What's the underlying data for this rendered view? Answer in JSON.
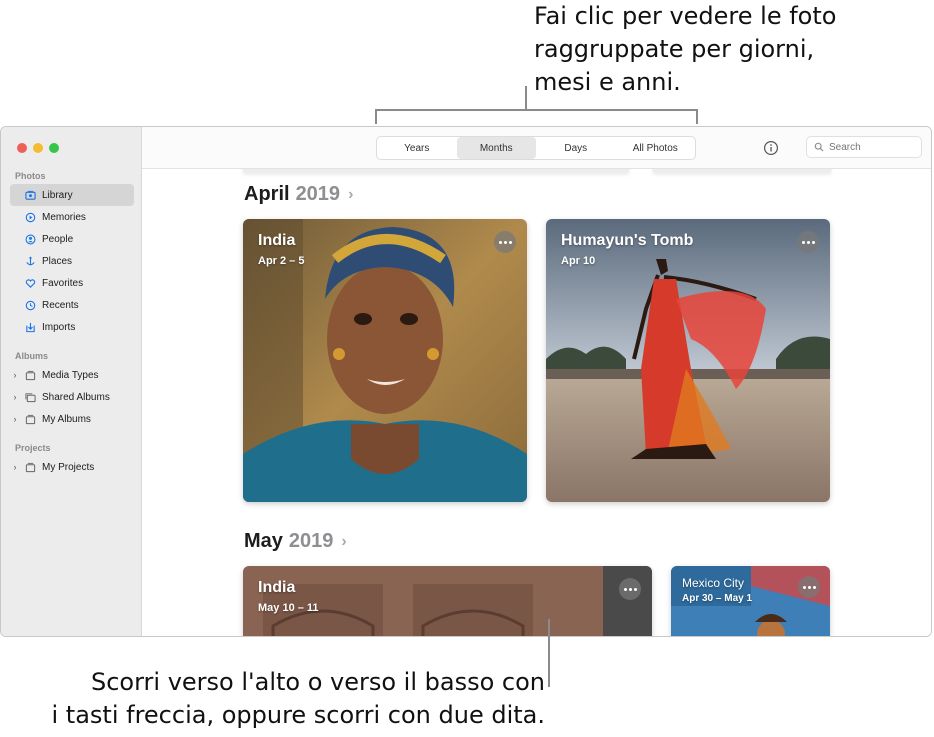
{
  "callouts": {
    "top": [
      "Fai clic per vedere le foto",
      "raggruppate per giorni,",
      "mesi e anni."
    ],
    "bottom": [
      "Scorri verso l'alto o verso il basso con",
      "i tasti freccia, oppure scorri con due dita."
    ]
  },
  "sidebar": {
    "sections": [
      {
        "title": "Photos",
        "items": [
          {
            "label": "Library",
            "icon": "library-icon",
            "active": true
          },
          {
            "label": "Memories",
            "icon": "memories-icon"
          },
          {
            "label": "People",
            "icon": "people-icon"
          },
          {
            "label": "Places",
            "icon": "places-icon"
          },
          {
            "label": "Favorites",
            "icon": "heart-icon"
          },
          {
            "label": "Recents",
            "icon": "clock-icon"
          },
          {
            "label": "Imports",
            "icon": "import-icon"
          }
        ]
      },
      {
        "title": "Albums",
        "items": [
          {
            "label": "Media Types",
            "icon": "folder-icon"
          },
          {
            "label": "Shared Albums",
            "icon": "shared-album-icon"
          },
          {
            "label": "My Albums",
            "icon": "folder-icon"
          }
        ]
      },
      {
        "title": "Projects",
        "items": [
          {
            "label": "My Projects",
            "icon": "folder-icon"
          }
        ]
      }
    ]
  },
  "toolbar": {
    "tabs": [
      "Years",
      "Months",
      "Days",
      "All Photos"
    ],
    "active_tab": "Months",
    "search_placeholder": "Search"
  },
  "content": {
    "months": [
      {
        "month": "April",
        "year": "2019",
        "cards": [
          {
            "title": "India",
            "date": "Apr 2 – 5"
          },
          {
            "title": "Humayun's Tomb",
            "date": "Apr 10"
          }
        ]
      },
      {
        "month": "May",
        "year": "2019",
        "cards": [
          {
            "title": "India",
            "date": "May 10 – 11"
          },
          {
            "title": "Mexico City",
            "date": "Apr 30 – May 1"
          }
        ]
      }
    ]
  },
  "colors": {
    "accent": "#1a73e8",
    "sidebar_bg": "#ececec",
    "active_item_bg": "#d5d5d5"
  }
}
